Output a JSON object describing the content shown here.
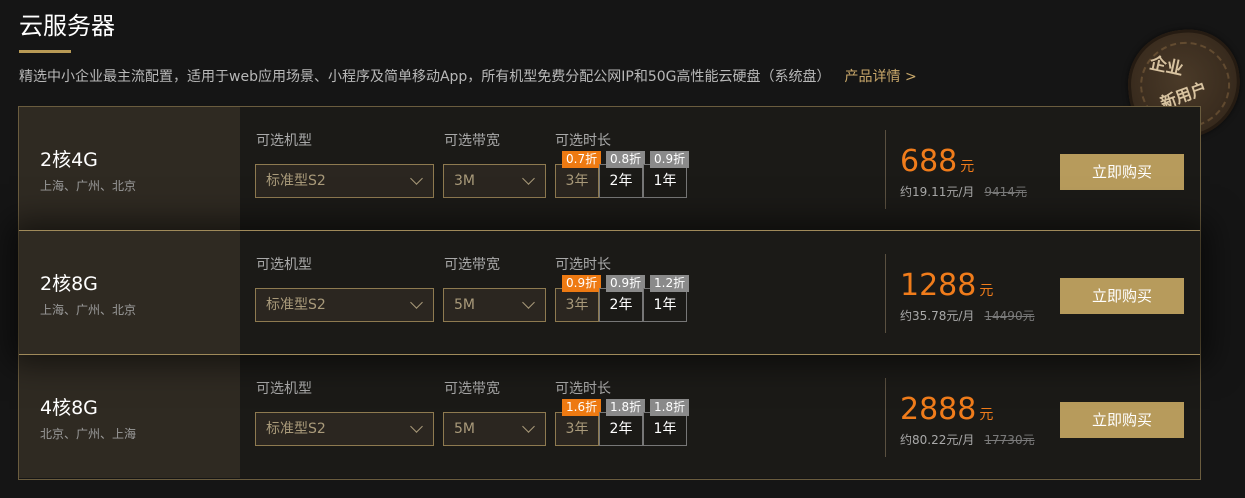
{
  "header": {
    "title": "云服务器",
    "description": "精选中小企业最主流配置，适用于web应用场景、小程序及简单移动App，所有机型免费分配公网IP和50G高性能云硬盘（系统盘）",
    "details_link": "产品详情 >"
  },
  "badge": {
    "line1": "企业",
    "line2": "新用户"
  },
  "labels": {
    "model": "可选机型",
    "bandwidth": "可选带宽",
    "duration": "可选时长"
  },
  "colors": {
    "accent": "#b79b5c",
    "price": "#f07c1b",
    "discount_hot": "#ee7a12",
    "discount": "#8a8a8a"
  },
  "plans": [
    {
      "name": "2核4G",
      "regions": "上海、广州、北京",
      "model": "标准型S2",
      "bandwidth": "3M",
      "durations": [
        {
          "label": "3年",
          "discount": "0.7折"
        },
        {
          "label": "2年",
          "discount": "0.8折"
        },
        {
          "label": "1年",
          "discount": "0.9折"
        }
      ],
      "price": "688",
      "price_unit": "元",
      "monthly": "约19.11元/月",
      "original": "9414元",
      "buy": "立即购买"
    },
    {
      "name": "2核8G",
      "regions": "上海、广州、北京",
      "model": "标准型S2",
      "bandwidth": "5M",
      "durations": [
        {
          "label": "3年",
          "discount": "0.9折"
        },
        {
          "label": "2年",
          "discount": "0.9折"
        },
        {
          "label": "1年",
          "discount": "1.2折"
        }
      ],
      "price": "1288",
      "price_unit": "元",
      "monthly": "约35.78元/月",
      "original": "14490元",
      "buy": "立即购买"
    },
    {
      "name": "4核8G",
      "regions": "北京、广州、上海",
      "model": "标准型S2",
      "bandwidth": "5M",
      "durations": [
        {
          "label": "3年",
          "discount": "1.6折"
        },
        {
          "label": "2年",
          "discount": "1.8折"
        },
        {
          "label": "1年",
          "discount": "1.8折"
        }
      ],
      "price": "2888",
      "price_unit": "元",
      "monthly": "约80.22元/月",
      "original": "17730元",
      "buy": "立即购买"
    }
  ]
}
